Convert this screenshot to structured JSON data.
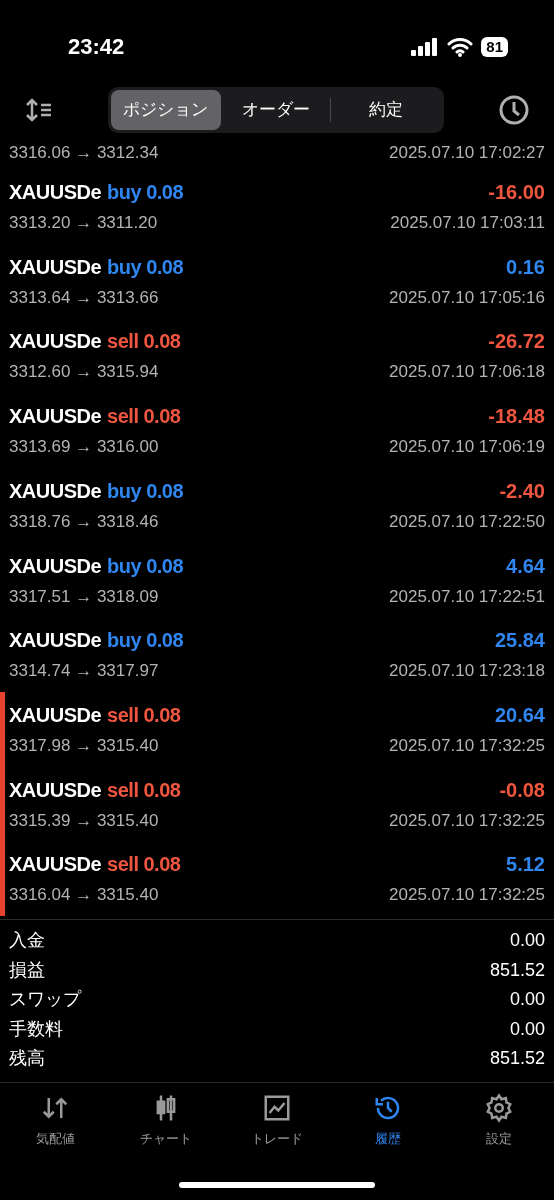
{
  "status_bar": {
    "time": "23:42",
    "battery": "81"
  },
  "tabs": [
    {
      "label": "ポジション",
      "selected": true
    },
    {
      "label": "オーダー",
      "selected": false
    },
    {
      "label": "約定",
      "selected": false
    }
  ],
  "partial_row": {
    "prices": "3316.06 → 3312.34",
    "time": "2025.07.10 17:02:27"
  },
  "deals": [
    {
      "symbol": "XAUUSDe",
      "kind": "buy",
      "action": "buy 0.08",
      "profit": "-16.00",
      "loss": true,
      "prices": "3313.20 → 3311.20",
      "time": "2025.07.10 17:03:11",
      "marked": false
    },
    {
      "symbol": "XAUUSDe",
      "kind": "buy",
      "action": "buy 0.08",
      "profit": "0.16",
      "loss": false,
      "prices": "3313.64 → 3313.66",
      "time": "2025.07.10 17:05:16",
      "marked": false
    },
    {
      "symbol": "XAUUSDe",
      "kind": "sell",
      "action": "sell 0.08",
      "profit": "-26.72",
      "loss": true,
      "prices": "3312.60 → 3315.94",
      "time": "2025.07.10 17:06:18",
      "marked": false
    },
    {
      "symbol": "XAUUSDe",
      "kind": "sell",
      "action": "sell 0.08",
      "profit": "-18.48",
      "loss": true,
      "prices": "3313.69 → 3316.00",
      "time": "2025.07.10 17:06:19",
      "marked": false
    },
    {
      "symbol": "XAUUSDe",
      "kind": "buy",
      "action": "buy 0.08",
      "profit": "-2.40",
      "loss": true,
      "prices": "3318.76 → 3318.46",
      "time": "2025.07.10 17:22:50",
      "marked": false
    },
    {
      "symbol": "XAUUSDe",
      "kind": "buy",
      "action": "buy 0.08",
      "profit": "4.64",
      "loss": false,
      "prices": "3317.51 → 3318.09",
      "time": "2025.07.10 17:22:51",
      "marked": false
    },
    {
      "symbol": "XAUUSDe",
      "kind": "buy",
      "action": "buy 0.08",
      "profit": "25.84",
      "loss": false,
      "prices": "3314.74 → 3317.97",
      "time": "2025.07.10 17:23:18",
      "marked": false
    },
    {
      "symbol": "XAUUSDe",
      "kind": "sell",
      "action": "sell 0.08",
      "profit": "20.64",
      "loss": false,
      "prices": "3317.98 → 3315.40",
      "time": "2025.07.10 17:32:25",
      "marked": true
    },
    {
      "symbol": "XAUUSDe",
      "kind": "sell",
      "action": "sell 0.08",
      "profit": "-0.08",
      "loss": true,
      "prices": "3315.39 → 3315.40",
      "time": "2025.07.10 17:32:25",
      "marked": true
    },
    {
      "symbol": "XAUUSDe",
      "kind": "sell",
      "action": "sell 0.08",
      "profit": "5.12",
      "loss": false,
      "prices": "3316.04 → 3315.40",
      "time": "2025.07.10 17:32:25",
      "marked": true
    }
  ],
  "summary": [
    {
      "label": "入金",
      "value": "0.00"
    },
    {
      "label": "損益",
      "value": "851.52"
    },
    {
      "label": "スワップ",
      "value": "0.00"
    },
    {
      "label": "手数料",
      "value": "0.00"
    },
    {
      "label": "残高",
      "value": "851.52"
    }
  ],
  "bottom_nav": [
    {
      "kind": "quotes",
      "label": "気配値",
      "selected": false
    },
    {
      "kind": "chart",
      "label": "チャート",
      "selected": false
    },
    {
      "kind": "trade",
      "label": "トレード",
      "selected": false
    },
    {
      "kind": "history",
      "label": "履歴",
      "selected": true
    },
    {
      "kind": "settings",
      "label": "設定",
      "selected": false
    }
  ]
}
